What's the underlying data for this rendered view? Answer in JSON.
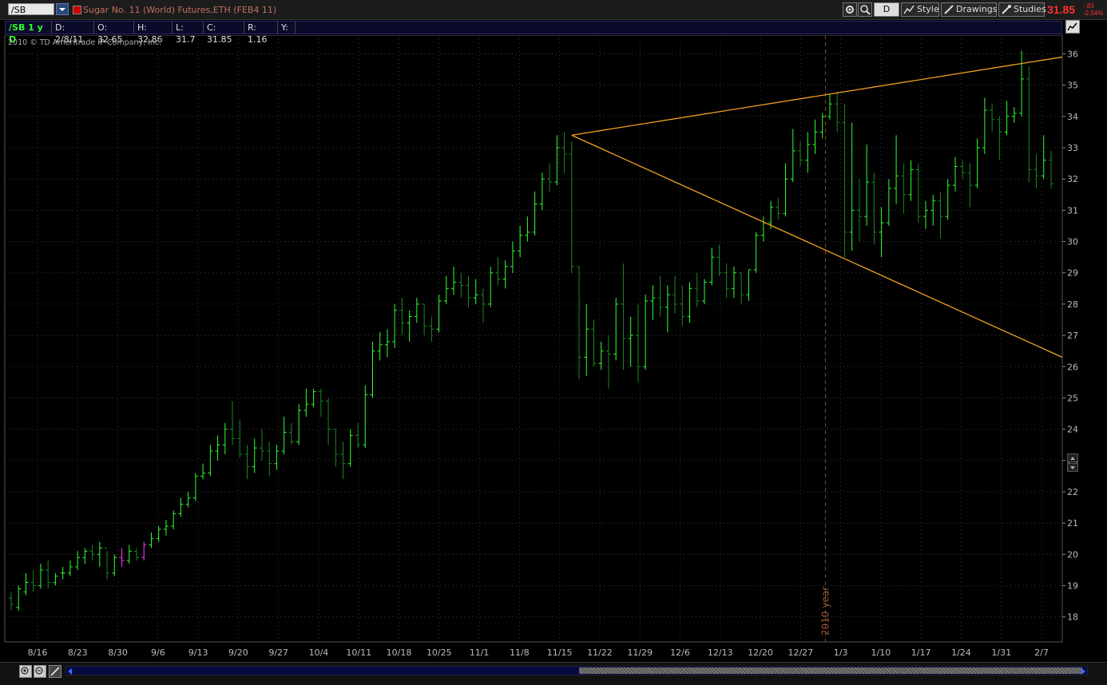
{
  "toolbar": {
    "symbol": "/SB",
    "description": "Sugar No. 11 (World)  Futures,ETH (FEB4 11)",
    "period": "D",
    "style_label": "Style",
    "drawings_label": "Drawings",
    "studies_label": "Studies",
    "last_price": "31.85",
    "change": "-.83",
    "change_pct": "-2.54%"
  },
  "info": {
    "symbol_period": "/SB 1 y D",
    "date": "D: 2/8/11",
    "open": "O: 32.65",
    "high": "H: 32.86",
    "low": "L: 31.7",
    "close": "C: 31.85",
    "range": "R: 1.16",
    "y": "Y:"
  },
  "copyright": "2010 © TD Ameritrade IP Company, Inc.",
  "colors": {
    "background": "#000000",
    "grid": "#3a3a3a",
    "up_bar": "#33ff33",
    "down_bar": "#1a8a1a",
    "special_bar": "#ff33ff",
    "trendline": "#f0a020",
    "axis_text": "#bbbbbb"
  },
  "chart_data": {
    "type": "ohlc",
    "title": "",
    "ylim": [
      17.2,
      36.6
    ],
    "y_ticks": [
      "18",
      "19",
      "20",
      "21",
      "22",
      "23",
      "24",
      "25",
      "26",
      "27",
      "28",
      "29",
      "30",
      "31",
      "32",
      "33",
      "34",
      "35",
      "36"
    ],
    "x_tick_labels": [
      "8/16",
      "8/23",
      "8/30",
      "9/6",
      "9/13",
      "9/20",
      "9/27",
      "10/4",
      "10/11",
      "10/18",
      "10/25",
      "11/1",
      "11/8",
      "11/15",
      "11/22",
      "11/29",
      "12/6",
      "12/13",
      "12/20",
      "12/27",
      "1/3",
      "1/10",
      "1/17",
      "1/24",
      "1/31",
      "2/7"
    ],
    "year_marker": {
      "label": "2010 year",
      "between": [
        "12/31",
        "1/3"
      ]
    },
    "bars": [
      {
        "o": 18.6,
        "h": 18.8,
        "l": 18.2,
        "c": 18.4
      },
      {
        "o": 18.3,
        "h": 19.0,
        "l": 18.2,
        "c": 18.9
      },
      {
        "o": 18.8,
        "h": 19.4,
        "l": 18.7,
        "c": 19.1
      },
      {
        "o": 19.1,
        "h": 19.5,
        "l": 18.8,
        "c": 19.0
      },
      {
        "o": 19.0,
        "h": 19.7,
        "l": 18.9,
        "c": 19.5
      },
      {
        "o": 19.5,
        "h": 19.8,
        "l": 18.9,
        "c": 19.1
      },
      {
        "o": 19.1,
        "h": 19.4,
        "l": 19.0,
        "c": 19.3
      },
      {
        "o": 19.4,
        "h": 19.6,
        "l": 19.2,
        "c": 19.4
      },
      {
        "o": 19.4,
        "h": 19.8,
        "l": 19.3,
        "c": 19.6
      },
      {
        "o": 19.6,
        "h": 20.1,
        "l": 19.5,
        "c": 19.9
      },
      {
        "o": 19.9,
        "h": 20.2,
        "l": 19.7,
        "c": 20.1
      },
      {
        "o": 20.1,
        "h": 20.3,
        "l": 19.8,
        "c": 20.0
      },
      {
        "o": 20.0,
        "h": 20.4,
        "l": 19.6,
        "c": 20.2
      },
      {
        "o": 20.2,
        "h": 20.1,
        "l": 19.2,
        "c": 19.4
      },
      {
        "o": 19.4,
        "h": 20.0,
        "l": 19.3,
        "c": 19.9
      },
      {
        "o": 19.9,
        "h": 20.2,
        "l": 19.6,
        "c": 19.8
      },
      {
        "o": 19.8,
        "h": 20.3,
        "l": 19.7,
        "c": 20.1
      },
      {
        "o": 20.1,
        "h": 20.2,
        "l": 19.8,
        "c": 19.9
      },
      {
        "o": 19.9,
        "h": 20.4,
        "l": 19.8,
        "c": 20.3
      },
      {
        "o": 20.3,
        "h": 20.7,
        "l": 20.2,
        "c": 20.5
      },
      {
        "o": 20.5,
        "h": 20.9,
        "l": 20.4,
        "c": 20.8
      },
      {
        "o": 20.8,
        "h": 21.1,
        "l": 20.6,
        "c": 20.9
      },
      {
        "o": 20.9,
        "h": 21.4,
        "l": 20.8,
        "c": 21.3
      },
      {
        "o": 21.3,
        "h": 21.8,
        "l": 21.2,
        "c": 21.6
      },
      {
        "o": 21.6,
        "h": 22.0,
        "l": 21.5,
        "c": 21.8
      },
      {
        "o": 21.8,
        "h": 22.6,
        "l": 21.7,
        "c": 22.5
      },
      {
        "o": 22.5,
        "h": 22.9,
        "l": 22.4,
        "c": 22.6
      },
      {
        "o": 22.6,
        "h": 23.5,
        "l": 22.5,
        "c": 23.3
      },
      {
        "o": 23.3,
        "h": 23.8,
        "l": 23.0,
        "c": 23.5
      },
      {
        "o": 23.5,
        "h": 24.2,
        "l": 23.2,
        "c": 24.0
      },
      {
        "o": 24.0,
        "h": 24.9,
        "l": 23.5,
        "c": 23.7
      },
      {
        "o": 23.7,
        "h": 24.3,
        "l": 23.1,
        "c": 23.2
      },
      {
        "o": 23.2,
        "h": 23.5,
        "l": 22.4,
        "c": 22.8
      },
      {
        "o": 22.8,
        "h": 23.7,
        "l": 22.6,
        "c": 23.4
      },
      {
        "o": 23.4,
        "h": 24.0,
        "l": 23.0,
        "c": 23.3
      },
      {
        "o": 23.3,
        "h": 23.6,
        "l": 22.5,
        "c": 22.9
      },
      {
        "o": 22.9,
        "h": 23.5,
        "l": 22.7,
        "c": 23.3
      },
      {
        "o": 23.3,
        "h": 24.4,
        "l": 23.2,
        "c": 23.9
      },
      {
        "o": 23.9,
        "h": 24.2,
        "l": 23.5,
        "c": 23.6
      },
      {
        "o": 23.6,
        "h": 24.8,
        "l": 23.5,
        "c": 24.6
      },
      {
        "o": 24.6,
        "h": 25.3,
        "l": 24.4,
        "c": 24.8
      },
      {
        "o": 24.8,
        "h": 25.3,
        "l": 24.7,
        "c": 25.2
      },
      {
        "o": 25.2,
        "h": 25.3,
        "l": 24.4,
        "c": 24.9
      },
      {
        "o": 24.9,
        "h": 25.0,
        "l": 23.5,
        "c": 24.0
      },
      {
        "o": 24.0,
        "h": 24.0,
        "l": 22.8,
        "c": 23.2
      },
      {
        "o": 23.2,
        "h": 23.6,
        "l": 22.4,
        "c": 22.9
      },
      {
        "o": 22.9,
        "h": 24.0,
        "l": 22.8,
        "c": 23.8
      },
      {
        "o": 23.8,
        "h": 24.2,
        "l": 23.4,
        "c": 23.5
      },
      {
        "o": 23.5,
        "h": 25.4,
        "l": 23.4,
        "c": 25.1
      },
      {
        "o": 25.1,
        "h": 26.8,
        "l": 25.0,
        "c": 26.5
      },
      {
        "o": 26.5,
        "h": 27.1,
        "l": 26.2,
        "c": 26.7
      },
      {
        "o": 26.7,
        "h": 27.2,
        "l": 26.3,
        "c": 26.8
      },
      {
        "o": 26.8,
        "h": 28.0,
        "l": 26.6,
        "c": 27.8
      },
      {
        "o": 27.8,
        "h": 28.2,
        "l": 27.0,
        "c": 27.4
      },
      {
        "o": 27.4,
        "h": 27.8,
        "l": 26.8,
        "c": 27.6
      },
      {
        "o": 27.6,
        "h": 28.2,
        "l": 27.4,
        "c": 28.0
      },
      {
        "o": 28.0,
        "h": 28.0,
        "l": 27.0,
        "c": 27.3
      },
      {
        "o": 27.3,
        "h": 27.6,
        "l": 26.8,
        "c": 27.2
      },
      {
        "o": 27.2,
        "h": 28.3,
        "l": 27.1,
        "c": 28.1
      },
      {
        "o": 28.1,
        "h": 28.9,
        "l": 28.0,
        "c": 28.5
      },
      {
        "o": 28.5,
        "h": 29.2,
        "l": 28.3,
        "c": 28.7
      },
      {
        "o": 28.7,
        "h": 29.0,
        "l": 28.2,
        "c": 28.6
      },
      {
        "o": 28.6,
        "h": 28.9,
        "l": 27.9,
        "c": 28.2
      },
      {
        "o": 28.2,
        "h": 28.8,
        "l": 28.0,
        "c": 28.3
      },
      {
        "o": 28.3,
        "h": 28.5,
        "l": 27.4,
        "c": 28.0
      },
      {
        "o": 28.0,
        "h": 29.2,
        "l": 27.9,
        "c": 29.0
      },
      {
        "o": 29.0,
        "h": 29.5,
        "l": 28.6,
        "c": 28.8
      },
      {
        "o": 28.8,
        "h": 29.4,
        "l": 28.5,
        "c": 29.2
      },
      {
        "o": 29.2,
        "h": 30.0,
        "l": 29.0,
        "c": 29.7
      },
      {
        "o": 29.7,
        "h": 30.5,
        "l": 29.5,
        "c": 30.2
      },
      {
        "o": 30.2,
        "h": 30.8,
        "l": 30.0,
        "c": 30.3
      },
      {
        "o": 30.3,
        "h": 31.6,
        "l": 30.2,
        "c": 31.2
      },
      {
        "o": 31.2,
        "h": 32.2,
        "l": 31.0,
        "c": 32.0
      },
      {
        "o": 32.0,
        "h": 32.5,
        "l": 31.6,
        "c": 31.9
      },
      {
        "o": 31.9,
        "h": 33.4,
        "l": 31.8,
        "c": 33.0
      },
      {
        "o": 33.0,
        "h": 33.5,
        "l": 32.2,
        "c": 32.8
      },
      {
        "o": 32.8,
        "h": 33.2,
        "l": 29.0,
        "c": 29.2
      },
      {
        "o": 29.2,
        "h": 29.2,
        "l": 25.6,
        "c": 26.3
      },
      {
        "o": 26.3,
        "h": 28.0,
        "l": 25.7,
        "c": 27.2
      },
      {
        "o": 27.2,
        "h": 27.5,
        "l": 26.0,
        "c": 26.1
      },
      {
        "o": 26.1,
        "h": 26.8,
        "l": 25.9,
        "c": 26.5
      },
      {
        "o": 26.5,
        "h": 27.0,
        "l": 25.3,
        "c": 26.4
      },
      {
        "o": 26.4,
        "h": 28.2,
        "l": 26.2,
        "c": 28.0
      },
      {
        "o": 28.0,
        "h": 29.3,
        "l": 25.9,
        "c": 26.9
      },
      {
        "o": 26.9,
        "h": 27.6,
        "l": 26.0,
        "c": 27.0
      },
      {
        "o": 27.0,
        "h": 28.0,
        "l": 25.5,
        "c": 26.0
      },
      {
        "o": 26.0,
        "h": 28.3,
        "l": 25.9,
        "c": 28.1
      },
      {
        "o": 28.1,
        "h": 28.6,
        "l": 27.5,
        "c": 28.2
      },
      {
        "o": 28.2,
        "h": 28.9,
        "l": 27.6,
        "c": 27.9
      },
      {
        "o": 27.9,
        "h": 28.6,
        "l": 27.1,
        "c": 28.3
      },
      {
        "o": 28.3,
        "h": 28.9,
        "l": 27.7,
        "c": 28.0
      },
      {
        "o": 28.0,
        "h": 28.6,
        "l": 27.3,
        "c": 27.6
      },
      {
        "o": 27.6,
        "h": 28.7,
        "l": 27.4,
        "c": 28.5
      },
      {
        "o": 28.5,
        "h": 29.0,
        "l": 27.9,
        "c": 28.1
      },
      {
        "o": 28.1,
        "h": 28.8,
        "l": 28.0,
        "c": 28.7
      },
      {
        "o": 28.7,
        "h": 29.8,
        "l": 28.6,
        "c": 29.5
      },
      {
        "o": 29.5,
        "h": 29.9,
        "l": 28.9,
        "c": 29.0
      },
      {
        "o": 29.0,
        "h": 29.3,
        "l": 28.2,
        "c": 28.5
      },
      {
        "o": 28.5,
        "h": 29.2,
        "l": 28.2,
        "c": 29.0
      },
      {
        "o": 29.0,
        "h": 29.0,
        "l": 28.0,
        "c": 28.3
      },
      {
        "o": 28.3,
        "h": 29.1,
        "l": 28.1,
        "c": 29.1
      },
      {
        "o": 29.1,
        "h": 30.3,
        "l": 29.0,
        "c": 30.2
      },
      {
        "o": 30.2,
        "h": 30.8,
        "l": 30.0,
        "c": 30.6
      },
      {
        "o": 30.6,
        "h": 31.3,
        "l": 30.4,
        "c": 31.1
      },
      {
        "o": 31.1,
        "h": 31.4,
        "l": 30.7,
        "c": 30.9
      },
      {
        "o": 30.9,
        "h": 32.5,
        "l": 30.8,
        "c": 32.0
      },
      {
        "o": 32.0,
        "h": 33.6,
        "l": 31.9,
        "c": 32.9
      },
      {
        "o": 32.9,
        "h": 33.2,
        "l": 32.4,
        "c": 32.6
      },
      {
        "o": 32.6,
        "h": 33.5,
        "l": 32.2,
        "c": 33.1
      },
      {
        "o": 33.1,
        "h": 33.9,
        "l": 32.8,
        "c": 33.5
      },
      {
        "o": 33.5,
        "h": 34.1,
        "l": 33.3,
        "c": 34.0
      },
      {
        "o": 34.0,
        "h": 34.7,
        "l": 33.9,
        "c": 34.4
      },
      {
        "o": 34.4,
        "h": 34.8,
        "l": 33.5,
        "c": 33.8
      },
      {
        "o": 33.8,
        "h": 34.4,
        "l": 29.5,
        "c": 30.3
      },
      {
        "o": 30.3,
        "h": 33.8,
        "l": 29.7,
        "c": 31.0
      },
      {
        "o": 31.0,
        "h": 32.0,
        "l": 30.0,
        "c": 30.8
      },
      {
        "o": 30.8,
        "h": 33.1,
        "l": 30.5,
        "c": 31.9
      },
      {
        "o": 31.9,
        "h": 32.2,
        "l": 29.9,
        "c": 30.3
      },
      {
        "o": 30.3,
        "h": 31.1,
        "l": 29.5,
        "c": 30.6
      },
      {
        "o": 30.6,
        "h": 32.0,
        "l": 30.5,
        "c": 31.7
      },
      {
        "o": 31.7,
        "h": 33.4,
        "l": 31.2,
        "c": 32.1
      },
      {
        "o": 32.1,
        "h": 32.5,
        "l": 30.9,
        "c": 31.5
      },
      {
        "o": 31.5,
        "h": 32.6,
        "l": 31.3,
        "c": 32.3
      },
      {
        "o": 32.3,
        "h": 32.5,
        "l": 30.6,
        "c": 30.8
      },
      {
        "o": 30.8,
        "h": 31.3,
        "l": 30.4,
        "c": 31.0
      },
      {
        "o": 31.0,
        "h": 31.5,
        "l": 30.5,
        "c": 31.3
      },
      {
        "o": 31.3,
        "h": 31.6,
        "l": 30.1,
        "c": 30.8
      },
      {
        "o": 30.8,
        "h": 32.0,
        "l": 30.7,
        "c": 31.8
      },
      {
        "o": 31.8,
        "h": 32.7,
        "l": 31.6,
        "c": 32.4
      },
      {
        "o": 32.4,
        "h": 32.6,
        "l": 32.0,
        "c": 32.2
      },
      {
        "o": 32.2,
        "h": 32.5,
        "l": 31.1,
        "c": 31.8
      },
      {
        "o": 31.8,
        "h": 33.3,
        "l": 31.7,
        "c": 33.0
      },
      {
        "o": 33.0,
        "h": 34.6,
        "l": 32.8,
        "c": 34.2
      },
      {
        "o": 34.2,
        "h": 34.4,
        "l": 33.5,
        "c": 33.9
      },
      {
        "o": 33.9,
        "h": 34.0,
        "l": 32.6,
        "c": 33.5
      },
      {
        "o": 33.5,
        "h": 34.5,
        "l": 33.4,
        "c": 34.0
      },
      {
        "o": 34.0,
        "h": 34.3,
        "l": 33.8,
        "c": 34.1
      },
      {
        "o": 34.1,
        "h": 36.1,
        "l": 34.0,
        "c": 35.2
      },
      {
        "o": 35.2,
        "h": 35.6,
        "l": 31.9,
        "c": 32.3
      },
      {
        "o": 32.3,
        "h": 32.8,
        "l": 31.7,
        "c": 32.1
      },
      {
        "o": 32.1,
        "h": 33.4,
        "l": 32.0,
        "c": 32.6
      },
      {
        "o": 32.6,
        "h": 32.9,
        "l": 31.7,
        "c": 31.85
      }
    ],
    "special_bars": [
      15,
      18
    ],
    "trendlines": [
      {
        "from": {
          "bar": 76,
          "price": 33.4
        },
        "to": {
          "bar": 146,
          "price": 35.9
        }
      },
      {
        "from": {
          "bar": 76,
          "price": 33.4
        },
        "to": {
          "bar": 150,
          "price": 26.3
        }
      }
    ]
  }
}
